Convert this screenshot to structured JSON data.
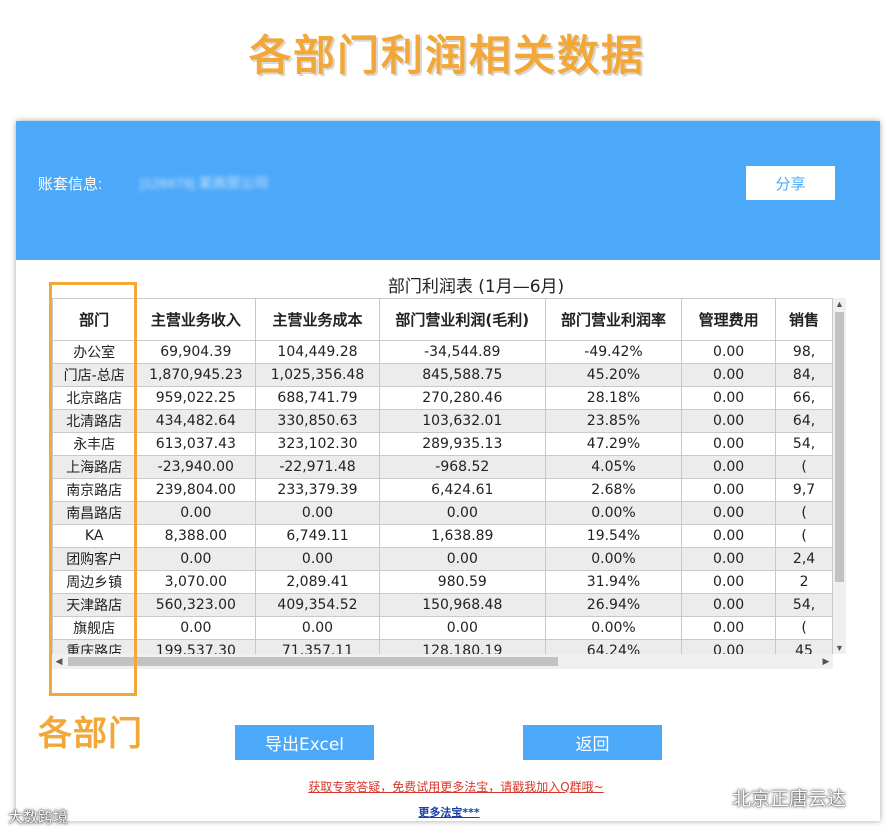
{
  "page_title": "各部门利润相关数据",
  "header": {
    "account_label": "账套信息:",
    "account_value": "[128479] 某商贸公司",
    "share_label": "分享",
    "accent_color": "#4ca8f8"
  },
  "table": {
    "caption": "部门利润表 (1月—6月)",
    "columns": [
      "部门",
      "主营业务收入",
      "主营业务成本",
      "部门营业利润(毛利)",
      "部门营业利润率",
      "管理费用",
      "销售"
    ],
    "rows": [
      [
        "办公室",
        "69,904.39",
        "104,449.28",
        "-34,544.89",
        "-49.42%",
        "0.00",
        "98,"
      ],
      [
        "门店-总店",
        "1,870,945.23",
        "1,025,356.48",
        "845,588.75",
        "45.20%",
        "0.00",
        "84,"
      ],
      [
        "北京路店",
        "959,022.25",
        "688,741.79",
        "270,280.46",
        "28.18%",
        "0.00",
        "66,"
      ],
      [
        "北清路店",
        "434,482.64",
        "330,850.63",
        "103,632.01",
        "23.85%",
        "0.00",
        "64,"
      ],
      [
        "永丰店",
        "613,037.43",
        "323,102.30",
        "289,935.13",
        "47.29%",
        "0.00",
        "54,"
      ],
      [
        "上海路店",
        "-23,940.00",
        "-22,971.48",
        "-968.52",
        "4.05%",
        "0.00",
        "("
      ],
      [
        "南京路店",
        "239,804.00",
        "233,379.39",
        "6,424.61",
        "2.68%",
        "0.00",
        "9,7"
      ],
      [
        "南昌路店",
        "0.00",
        "0.00",
        "0.00",
        "0.00%",
        "0.00",
        "("
      ],
      [
        "KA",
        "8,388.00",
        "6,749.11",
        "1,638.89",
        "19.54%",
        "0.00",
        "("
      ],
      [
        "团购客户",
        "0.00",
        "0.00",
        "0.00",
        "0.00%",
        "0.00",
        "2,4"
      ],
      [
        "周边乡镇",
        "3,070.00",
        "2,089.41",
        "980.59",
        "31.94%",
        "0.00",
        "2"
      ],
      [
        "天津路店",
        "560,323.00",
        "409,354.52",
        "150,968.48",
        "26.94%",
        "0.00",
        "54,"
      ],
      [
        "旗舰店",
        "0.00",
        "0.00",
        "0.00",
        "0.00%",
        "0.00",
        "("
      ],
      [
        "重庆路店",
        "199,537.30",
        "71,357.11",
        "128,180.19",
        "64.24%",
        "0.00",
        "45"
      ]
    ]
  },
  "annotation": {
    "label": "各部门",
    "color": "#f2a838"
  },
  "actions": {
    "export_label": "导出Excel",
    "back_label": "返回"
  },
  "links": {
    "promo": "获取专家答疑，免费试用更多法宝，请戳我加入Q群哦~",
    "more": "更多法宝***"
  },
  "watermarks": {
    "brand": "北京正唐云达",
    "brand_icon": "wechat-icon",
    "source": "大数跨境"
  }
}
